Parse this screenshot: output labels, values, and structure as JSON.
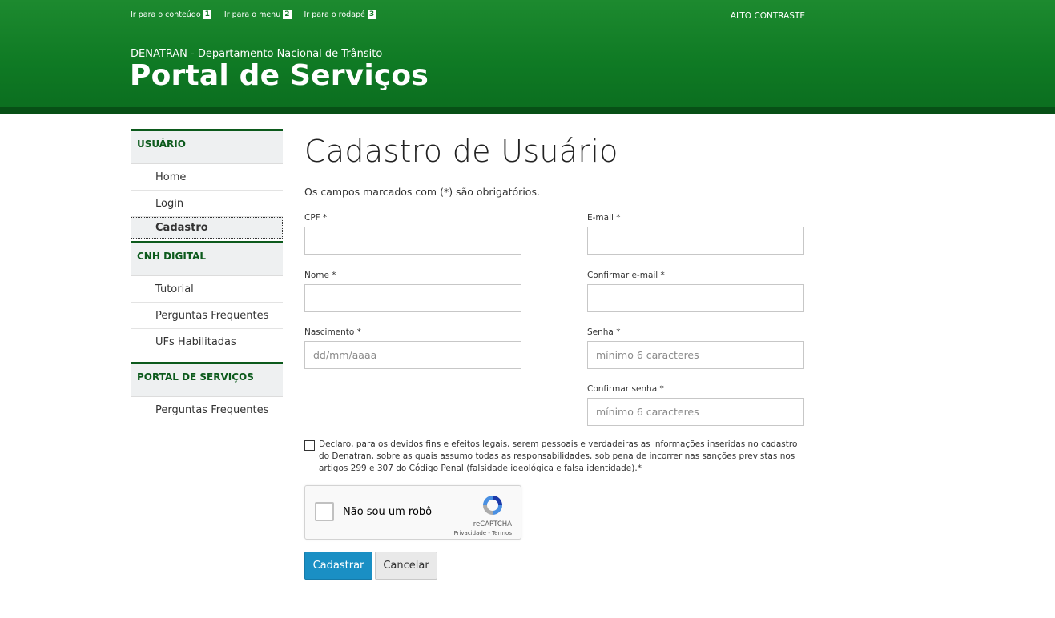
{
  "header": {
    "skip_links": [
      {
        "label": "Ir para o conteúdo",
        "num": "1"
      },
      {
        "label": "Ir para o menu",
        "num": "2"
      },
      {
        "label": "Ir para o rodapé",
        "num": "3"
      }
    ],
    "contrast": "ALTO CONTRASTE",
    "subtitle": "DENATRAN - Departamento Nacional de Trânsito",
    "title": "Portal de Serviços"
  },
  "sidebar": {
    "sections": [
      {
        "header": "USUÁRIO",
        "items": [
          "Home",
          "Login",
          "Cadastro"
        ]
      },
      {
        "header": "CNH DIGITAL",
        "items": [
          "Tutorial",
          "Perguntas Frequentes",
          "UFs Habilitadas"
        ]
      },
      {
        "header": "PORTAL DE SERVIÇOS",
        "items": [
          "Perguntas Frequentes"
        ]
      }
    ]
  },
  "main": {
    "title": "Cadastro de Usuário",
    "required_note": "Os campos marcados com (*) são obrigatórios.",
    "fields": {
      "cpf": {
        "label": "CPF *",
        "value": "",
        "placeholder": ""
      },
      "email": {
        "label": "E-mail *",
        "value": "",
        "placeholder": ""
      },
      "nome": {
        "label": "Nome *",
        "value": "",
        "placeholder": ""
      },
      "confirm_email": {
        "label": "Confirmar e-mail *",
        "value": "",
        "placeholder": ""
      },
      "nascimento": {
        "label": "Nascimento *",
        "value": "",
        "placeholder": "dd/mm/aaaa"
      },
      "senha": {
        "label": "Senha *",
        "value": "",
        "placeholder": "mínimo 6 caracteres"
      },
      "confirm_senha": {
        "label": "Confirmar senha *",
        "value": "",
        "placeholder": "mínimo 6 caracteres"
      }
    },
    "declaration": "Declaro, para os devidos fins e efeitos legais, serem pessoais e verdadeiras as informações inseridas no cadastro do Denatran, sobre as quais assumo todas as responsabilidades, sob pena de incorrer nas sanções previstas nos artigos 299 e 307 do Código Penal (falsidade ideológica e falsa identidade).*",
    "recaptcha": {
      "label": "Não sou um robô",
      "brand": "reCAPTCHA",
      "links": "Privacidade - Termos"
    },
    "buttons": {
      "submit": "Cadastrar",
      "cancel": "Cancelar"
    }
  },
  "colors": {
    "header_green": "#0f7a24",
    "primary_button": "#1a8fc4"
  }
}
